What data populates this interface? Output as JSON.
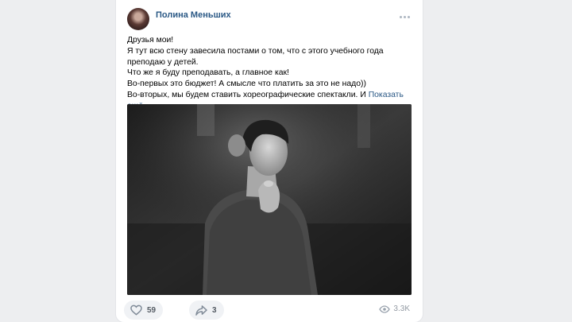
{
  "post": {
    "author": "Полина Меньших",
    "text": {
      "line1": "Друзья мои!",
      "line2": "Я тут всю стену завесила постами о том, что с этого учебного года преподаю у детей.",
      "line3": "Что же я буду преподавать, а главное как!",
      "line4": "Во-первых это бюджет! А смысле что платить за это не надо))",
      "line5_start": "Во-вторых, мы будем ставить хореографические спектакли. И",
      "line5_fade": " ",
      "show_more": "Показать ещё"
    },
    "likes": "59",
    "shares": "3",
    "views": "3.3K"
  },
  "icons": {
    "more": "more-horizontal-icon",
    "like": "heart-icon",
    "share": "share-arrow-icon",
    "views": "eye-icon"
  },
  "colors": {
    "link": "#2a5885",
    "background": "#edeef0",
    "button_bg": "#f0f2f5"
  }
}
